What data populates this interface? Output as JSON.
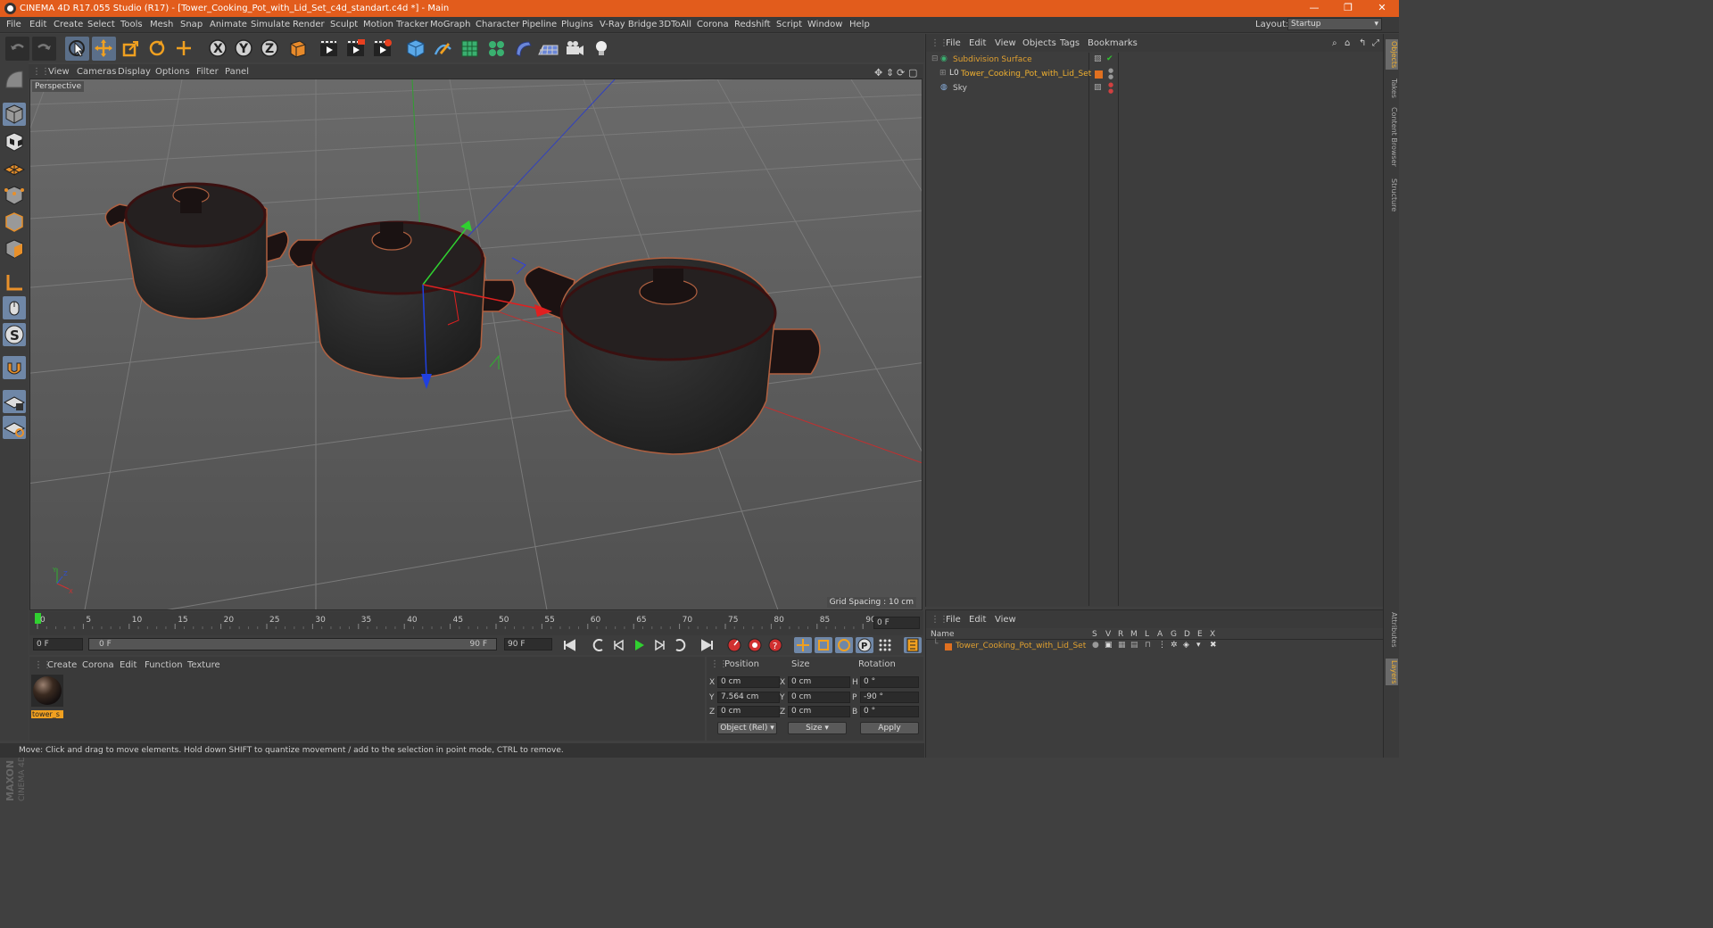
{
  "window": {
    "title": "CINEMA 4D R17.055 Studio (R17) - [Tower_Cooking_Pot_with_Lid_Set_c4d_standart.c4d *] - Main",
    "minimize": "—",
    "restore": "❐",
    "close": "✕"
  },
  "menu": [
    "File",
    "Edit",
    "Create",
    "Select",
    "Tools",
    "Mesh",
    "Snap",
    "Animate",
    "Simulate",
    "Render",
    "Sculpt",
    "Motion Tracker",
    "MoGraph",
    "Character",
    "Pipeline",
    "Plugins",
    "V-Ray Bridge",
    "3DToAll",
    "Corona",
    "Redshift",
    "Script",
    "Window",
    "Help"
  ],
  "layout": {
    "label": "Layout:",
    "value": "Startup"
  },
  "toolbar": {
    "icons": [
      "undo-icon",
      "redo-icon",
      "live-selection-icon",
      "move-icon",
      "scale-icon",
      "rotate-icon",
      "add-object-icon",
      "x-axis-lock-icon",
      "y-axis-lock-icon",
      "z-axis-lock-icon",
      "coordinate-system-icon",
      "render-view-icon",
      "render-picture-viewer-icon",
      "edit-render-settings-icon",
      "cube-primitive-icon",
      "pen-spline-icon",
      "subdivision-surface-icon",
      "cloner-icon",
      "deformer-icon",
      "floor-icon",
      "camera-icon",
      "light-icon"
    ],
    "x": "X",
    "y": "Y",
    "z": "Z"
  },
  "viewport": {
    "menu": [
      "View",
      "Cameras",
      "Display",
      "Options",
      "Filter",
      "Panel"
    ],
    "label": "Perspective",
    "grid_spacing": "Grid Spacing : 10 cm",
    "axis_x": "X",
    "axis_y": "Y",
    "axis_z": "Z"
  },
  "timeline": {
    "ticks": [
      "0",
      "5",
      "10",
      "15",
      "20",
      "25",
      "30",
      "35",
      "40",
      "45",
      "50",
      "55",
      "60",
      "65",
      "70",
      "75",
      "80",
      "85",
      "90"
    ],
    "end_field": "0 F",
    "current": "0 F",
    "range_start": "0 F",
    "range_end": "90 F",
    "max": "90 F"
  },
  "materials": {
    "menu": [
      "Create",
      "Corona",
      "Edit",
      "Function",
      "Texture"
    ],
    "items": [
      {
        "name": "tower_s"
      }
    ]
  },
  "coordinates": {
    "headers": [
      "Position",
      "Size",
      "Rotation"
    ],
    "rows": [
      {
        "axis": "X",
        "pos": "0 cm",
        "size_axis": "X",
        "size": "0 cm",
        "rot_axis": "H",
        "rot": "0 °"
      },
      {
        "axis": "Y",
        "pos": "7.564 cm",
        "size_axis": "Y",
        "size": "0 cm",
        "rot_axis": "P",
        "rot": "-90 °"
      },
      {
        "axis": "Z",
        "pos": "0 cm",
        "size_axis": "Z",
        "size": "0 cm",
        "rot_axis": "B",
        "rot": "0 °"
      }
    ],
    "mode": "Object (Rel)",
    "size_mode": "Size",
    "apply": "Apply"
  },
  "objects_panel": {
    "menu": [
      "File",
      "Edit",
      "View",
      "Objects",
      "Tags",
      "Bookmarks"
    ],
    "items": [
      {
        "name": "Subdivision Surface",
        "color": "#e0a030"
      },
      {
        "name": "Tower_Cooking_Pot_with_Lid_Set",
        "color": "#f0b030"
      },
      {
        "name": "Sky",
        "color": "#c8c8c8"
      }
    ]
  },
  "layers_panel": {
    "menu": [
      "File",
      "Edit",
      "View"
    ],
    "name_header": "Name",
    "flags": [
      "S",
      "V",
      "R",
      "M",
      "L",
      "A",
      "G",
      "D",
      "E",
      "X"
    ],
    "items": [
      {
        "name": "Tower_Cooking_Pot_with_Lid_Set",
        "color": "#e07020"
      }
    ]
  },
  "right_tabs": [
    "Objects",
    "Takes",
    "Content Browser",
    "Structure",
    "Attributes",
    "Layers"
  ],
  "maxon": {
    "brand": "MAXON",
    "product": "CINEMA 4D"
  },
  "status": "Move: Click and drag to move elements. Hold down SHIFT to quantize movement / add to the selection in point mode, CTRL to remove.",
  "colors": {
    "title_bar": "#e25c1c",
    "accent_blue": "#5b6f89",
    "selection_orange": "#f0a030"
  }
}
